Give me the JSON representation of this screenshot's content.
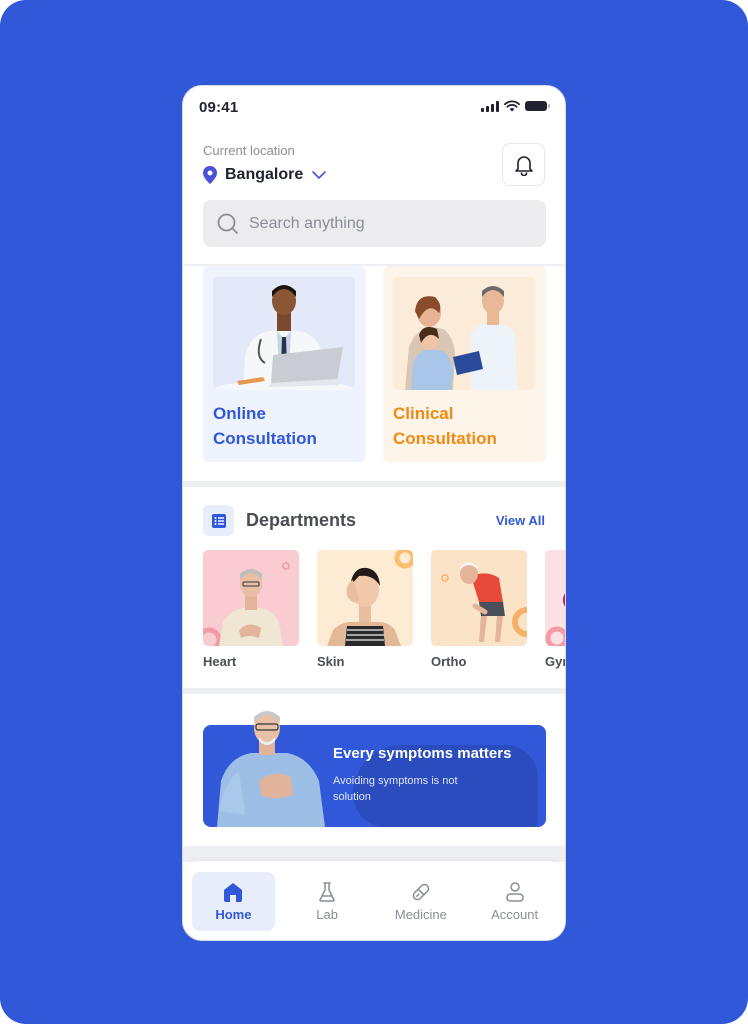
{
  "status_bar": {
    "time": "09:41"
  },
  "header": {
    "location_label": "Current location",
    "location_value": "Bangalore",
    "search_placeholder": "Search anything"
  },
  "consultations": [
    {
      "title_line1": "Online",
      "title_line2": "Consultation",
      "color": "#3058d9"
    },
    {
      "title_line1": "Clinical",
      "title_line2": "Consultation",
      "color": "#f08a14"
    }
  ],
  "departments": {
    "title": "Departments",
    "view_all_label": "View All",
    "items": [
      {
        "label": "Heart",
        "bg": "#f8ccd1"
      },
      {
        "label": "Skin",
        "bg": "#fdebd3"
      },
      {
        "label": "Ortho",
        "bg": "#fbe3c8"
      },
      {
        "label": "Gynecology",
        "bg": "#fbe1e4"
      }
    ]
  },
  "banner": {
    "title": "Every symptoms matters",
    "subtitle": "Avoiding symptoms is not solution"
  },
  "bottom_nav": {
    "items": [
      {
        "label": "Home",
        "icon": "home-icon",
        "active": true
      },
      {
        "label": "Lab",
        "icon": "flask-icon",
        "active": false
      },
      {
        "label": "Medicine",
        "icon": "pill-icon",
        "active": false
      },
      {
        "label": "Account",
        "icon": "user-icon",
        "active": false
      }
    ]
  },
  "colors": {
    "brand": "#3058d9",
    "accent_orange": "#f08a14",
    "background": "#3058d9"
  }
}
